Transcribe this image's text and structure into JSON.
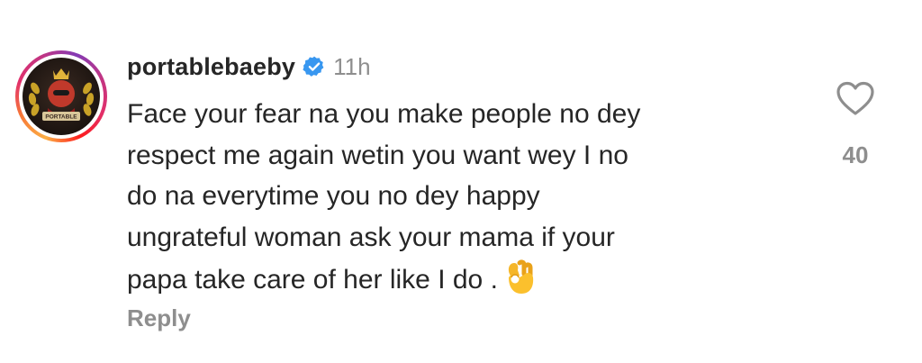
{
  "comment": {
    "username": "portablebaeby",
    "verified": true,
    "timestamp": "11h",
    "avatar_badge_text": "PORTABLE",
    "text_lines": [
      "Face your fear na you make people no dey",
      "respect me again wetin you want wey I no",
      "do na everytime you no dey happy",
      "ungrateful woman ask your mama if your",
      "papa take care of her like I do ."
    ],
    "emoji": "ok-hand-emoji",
    "reply_label": "Reply",
    "like_count": "40"
  },
  "colors": {
    "text": "#262626",
    "muted": "#8e8e8e",
    "verified_blue": "#3897f0"
  },
  "icons": [
    "verified-badge-icon",
    "heart-outline-icon",
    "ok-hand-emoji"
  ]
}
